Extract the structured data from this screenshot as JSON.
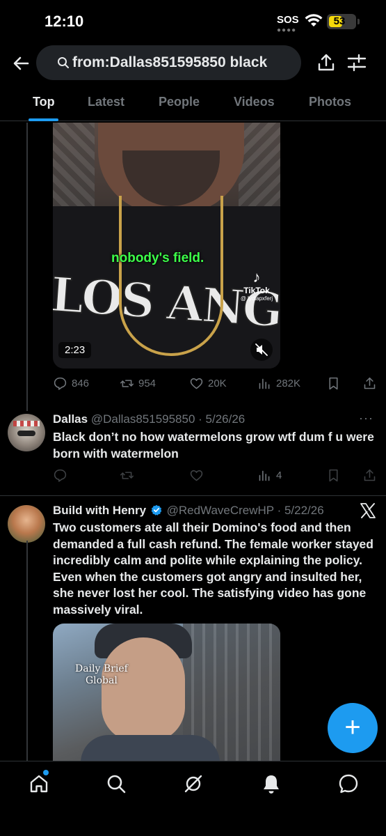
{
  "status_bar": {
    "time": "12:10",
    "sos": "SOS",
    "battery": "53",
    "battery_level": 0.53
  },
  "search": {
    "query": "from:Dallas851595850 black"
  },
  "tabs": [
    "Top",
    "Latest",
    "People",
    "Videos",
    "Photos"
  ],
  "active_tab": "Top",
  "post1": {
    "media": {
      "caption": "nobody's field.",
      "watermark_brand": "TikTok",
      "watermark_handle": "@ lydiapxferj",
      "shirt_text": "LOS ANGELES",
      "duration": "2:23"
    },
    "stats": {
      "replies": "846",
      "reposts": "954",
      "likes": "20K",
      "views": "282K"
    }
  },
  "post2": {
    "name": "Dallas",
    "handle": "@Dallas851595850",
    "date": "· 5/26/26",
    "more": "···",
    "text": "Black don’t no how watermelons grow wtf dum f u were born with watermelon",
    "stats": {
      "views": "4"
    }
  },
  "post3": {
    "name": "Build with Henry",
    "handle": "@RedWaveCrewHP",
    "date": "· 5/22/26",
    "verified": true,
    "text": "Two customers ate all their Domino's food and then demanded a full cash refund. The female worker stayed incredibly calm and polite while explaining the policy. Even when the customers got angry and insulted her, she never lost her cool. The satisfying video has gone massively viral.",
    "media": {
      "watermark_line1": "Daily Brief",
      "watermark_line2": "Global"
    }
  },
  "fab": {
    "label": "+"
  },
  "nav": [
    "home-icon",
    "search-icon",
    "grok-icon",
    "notifications-icon",
    "messages-icon"
  ],
  "colors": {
    "accent": "#1d9bf0",
    "background": "#000000",
    "muted": "#71767b",
    "text": "#e7e9ea",
    "caption_green": "#3dff4a"
  }
}
